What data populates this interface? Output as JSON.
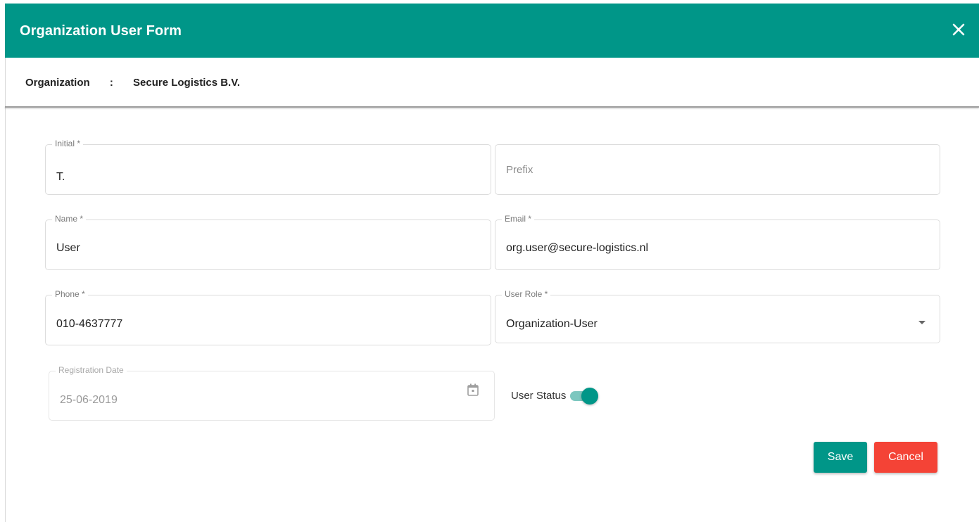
{
  "dialog": {
    "title": "Organization User Form",
    "close_icon": "close-icon"
  },
  "organization": {
    "label": "Organization",
    "separator": ":",
    "value": "Secure Logistics B.V."
  },
  "form": {
    "initial": {
      "label": "Initial *",
      "value": "T."
    },
    "prefix": {
      "placeholder": "Prefix",
      "value": ""
    },
    "name": {
      "label": "Name *",
      "value": "User"
    },
    "email": {
      "label": "Email *",
      "value": "org.user@secure-logistics.nl"
    },
    "phone": {
      "label": "Phone *",
      "value": "010-4637777"
    },
    "user_role": {
      "label": "User Role *",
      "value": "Organization-User",
      "icon": "chevron-down-icon"
    },
    "registration_date": {
      "label": "Registration Date",
      "value": "25-06-2019",
      "icon": "calendar-icon",
      "disabled": true
    },
    "user_status": {
      "label": "User Status",
      "enabled": true
    }
  },
  "buttons": {
    "save": "Save",
    "cancel": "Cancel"
  },
  "colors": {
    "primary": "#009688",
    "danger": "#f44336",
    "toggle_track": "#7cc7bf"
  }
}
